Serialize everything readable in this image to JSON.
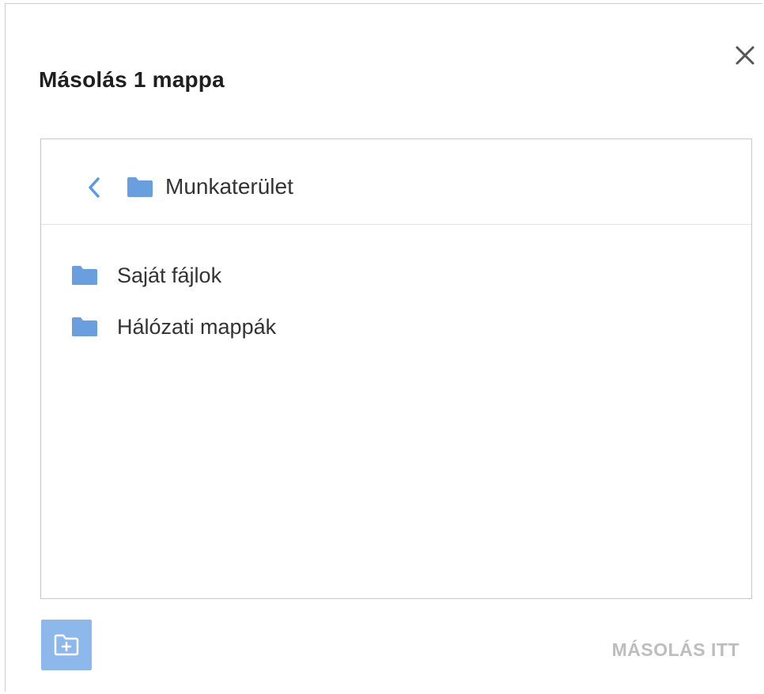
{
  "dialog": {
    "title": "Másolás 1 mappa",
    "close_icon": "close-icon"
  },
  "browser": {
    "current_folder": "Munkaterület",
    "back_icon": "chevron-left-icon",
    "folder_icon": "folder-icon",
    "items": [
      {
        "label": "Saját fájlok",
        "icon": "folder-icon"
      },
      {
        "label": "Hálózati mappák",
        "icon": "folder-icon"
      }
    ]
  },
  "footer": {
    "new_folder_icon": "new-folder-icon",
    "copy_here_label": "MÁSOLÁS ITT"
  },
  "colors": {
    "accent": "#5a9ae6",
    "folder": "#6a9fdf",
    "new_folder_button": "#8db8ec",
    "disabled_text": "#bdbdbd",
    "title_text": "#1f1f1f"
  }
}
